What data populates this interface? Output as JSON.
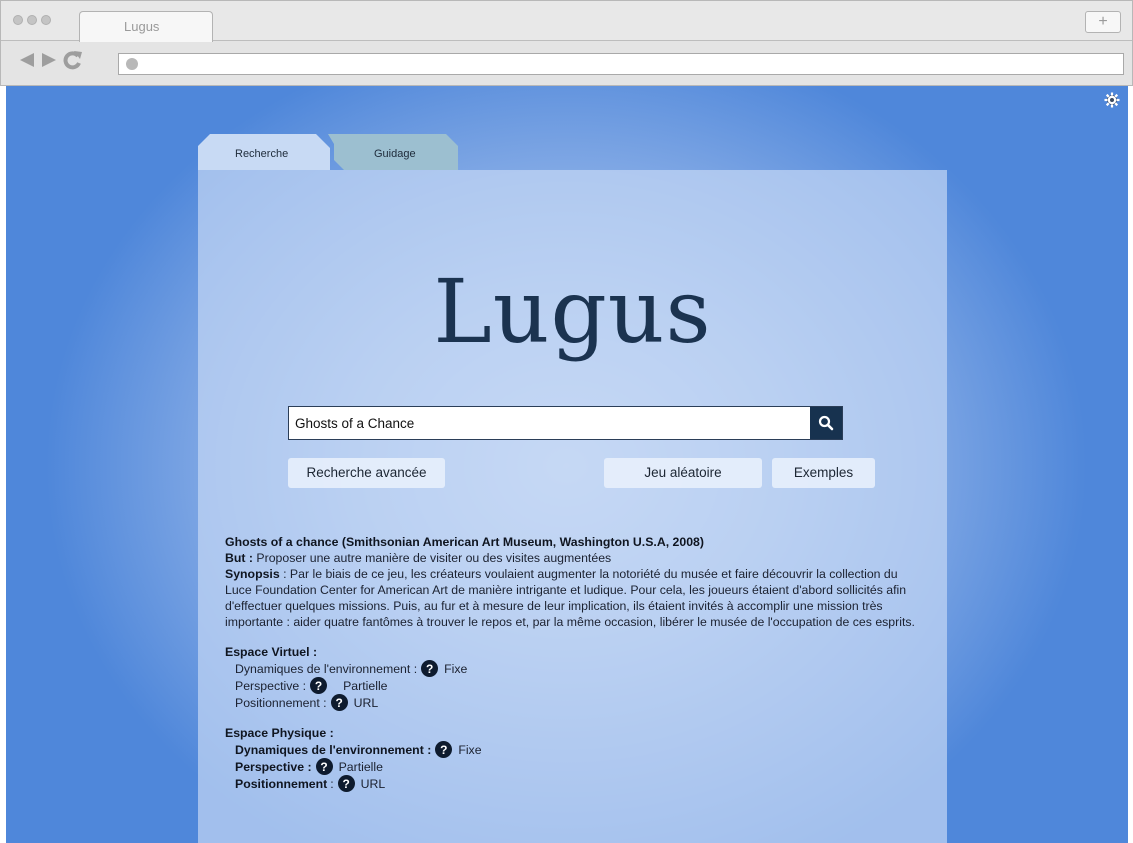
{
  "browser": {
    "tab_title": "Lugus",
    "newtab_label": "+",
    "url": ""
  },
  "page": {
    "tabs": [
      {
        "label": "Recherche",
        "active": true
      },
      {
        "label": "Guidage",
        "active": false
      }
    ],
    "logo": "Lugus",
    "search": {
      "value": "Ghosts of a Chance",
      "placeholder": ""
    },
    "buttons": {
      "advanced": "Recherche avancée",
      "random": "Jeu aléatoire",
      "examples": "Exemples"
    },
    "result": {
      "title": "Ghosts of a chance (Smithsonian American Art Museum, Washington U.S.A, 2008)",
      "goal_label": "But :",
      "goal_text": "Proposer une autre manière de visiter ou des visites augmentées",
      "synopsis_label": "Synopsis",
      "synopsis_text": " : Par le biais de ce jeu, les créateurs voulaient augmenter la notoriété du musée et faire découvrir la collection du Luce Foundation Center for American Art de manière intrigante et ludique. Pour cela, les joueurs étaient d'abord sollicités afin d'effectuer quelques missions. Puis, au fur et à mesure de leur implication, ils étaient invités à accomplir une mission très importante : aider quatre fantômes à trouver le repos et, par la même occasion, libérer le musée de l'occupation de ces esprits.",
      "virtual": {
        "heading": "Espace Virtuel :",
        "dyn_label": "Dynamiques de l'environnement :",
        "dyn_value": "Fixe",
        "persp_label": "Perspective :",
        "persp_value": "Partielle",
        "pos_label": "Positionnement :",
        "pos_value": "URL"
      },
      "physical": {
        "heading": "Espace Physique :",
        "dyn_label": "Dynamiques de l'environnement :",
        "dyn_value": "Fixe",
        "persp_label": "Perspective :",
        "persp_value": "Partielle",
        "pos_label": "Positionnement",
        "pos_sep": ":",
        "pos_value": "URL"
      },
      "help_glyph": "?"
    }
  },
  "colors": {
    "accent_dark": "#17324f",
    "bg_blue": "#4f87da"
  },
  "icons": [
    "back-arrow-icon",
    "forward-arrow-icon",
    "reload-icon",
    "search-icon",
    "help-icon",
    "settings-gear-icon"
  ]
}
